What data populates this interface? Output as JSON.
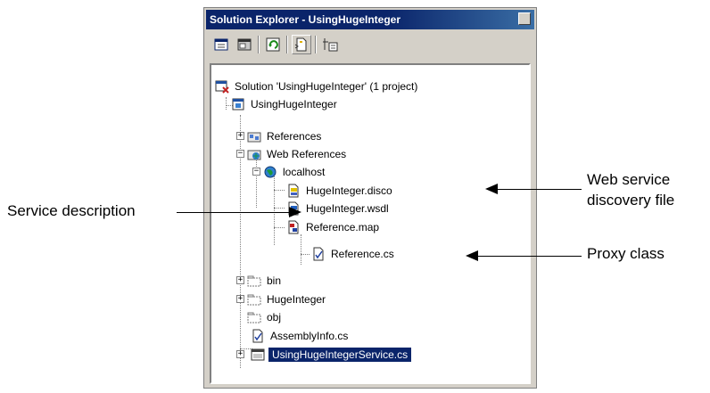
{
  "window": {
    "title": "Solution Explorer - UsingHugeInteger"
  },
  "toolbar": {
    "buttons": [
      {
        "name": "properties-icon"
      },
      {
        "name": "view-code-icon"
      },
      {
        "name": "refresh-icon"
      },
      {
        "name": "show-all-files-icon"
      },
      {
        "name": "view-designer-icon"
      }
    ]
  },
  "tree": {
    "solution": "Solution 'UsingHugeInteger' (1 project)",
    "project": "UsingHugeInteger",
    "references": "References",
    "web_references": "Web References",
    "localhost": "localhost",
    "disco_file": "HugeInteger.disco",
    "wsdl_file": "HugeInteger.wsdl",
    "reference_map": "Reference.map",
    "reference_cs": "Reference.cs",
    "bin": "bin",
    "hugeinteger_folder": "HugeInteger",
    "obj": "obj",
    "assembly_info": "AssemblyInfo.cs",
    "selected_file": "UsingHugeIntegerService.cs"
  },
  "callouts": {
    "service_description": "Service description",
    "web_service_line1": "Web service",
    "web_service_line2": "discovery file",
    "proxy_class": "Proxy class"
  }
}
